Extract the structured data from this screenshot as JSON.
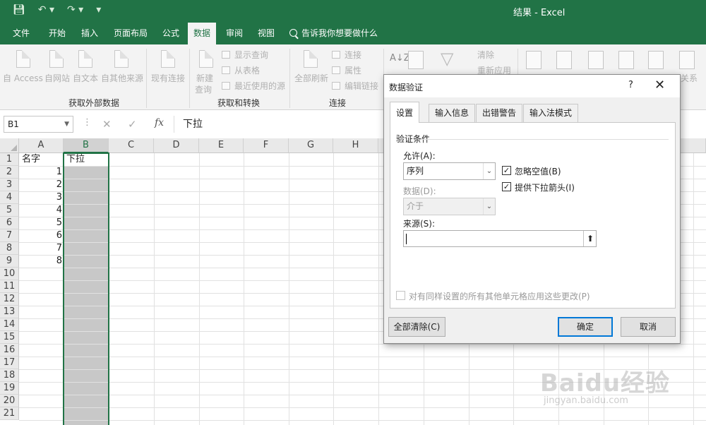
{
  "window": {
    "title": "结果  -  Excel"
  },
  "qat": {
    "save_icon": "save-icon",
    "undo_icon": "undo-icon",
    "redo_icon": "redo-icon"
  },
  "tabs": [
    {
      "label": "文件"
    },
    {
      "label": "开始"
    },
    {
      "label": "插入"
    },
    {
      "label": "页面布局"
    },
    {
      "label": "公式"
    },
    {
      "label": "数据",
      "active": true
    },
    {
      "label": "审阅"
    },
    {
      "label": "视图"
    }
  ],
  "tell_me": "告诉我你想要做什么",
  "ribbon": {
    "get_external": {
      "name": "获取外部数据",
      "access": "自 Access",
      "web": "自网站",
      "text": "自文本",
      "other": "自其他来源",
      "existing": "现有连接"
    },
    "get_transform": {
      "name": "获取和转换",
      "new_query": "新建",
      "new_query2": "查询",
      "show_query": "显示查询",
      "from_table": "从表格",
      "recent": "最近使用的源"
    },
    "connections": {
      "name": "连接",
      "refresh_all": "全部刷新",
      "connections": "连接",
      "properties": "属性",
      "edit_links": "编辑链接"
    },
    "sort_filter": {
      "clear": "清除",
      "reapply": "重新应用"
    },
    "relations": "关系"
  },
  "formula_bar": {
    "name_box": "B1",
    "value": "下拉"
  },
  "columns": [
    "A",
    "B",
    "C",
    "D",
    "E",
    "F",
    "G",
    "H"
  ],
  "rows": [
    "1",
    "2",
    "3",
    "4",
    "5",
    "6",
    "7",
    "8",
    "9",
    "10",
    "11",
    "12",
    "13",
    "14",
    "15",
    "16",
    "17",
    "18",
    "19",
    "20",
    "21"
  ],
  "cells": {
    "a1": "名字",
    "b1": "下拉",
    "a2": "1",
    "a3": "2",
    "a4": "3",
    "a5": "4",
    "a6": "5",
    "a7": "6",
    "a8": "7",
    "a9": "8"
  },
  "dialog": {
    "title": "数据验证",
    "help": "?",
    "close": "✕",
    "tabs": [
      "设置",
      "输入信息",
      "出错警告",
      "输入法模式"
    ],
    "group_label": "验证条件",
    "allow_label": "允许(A):",
    "allow_value": "序列",
    "data_label": "数据(D):",
    "data_value": "介于",
    "ignore_blank": "忽略空值(B)",
    "dropdown_arrow": "提供下拉箭头(I)",
    "source_label": "来源(S):",
    "source_value": "",
    "apply_all": "对有同样设置的所有其他单元格应用这些更改(P)",
    "clear_all": "全部清除(C)",
    "ok": "确定",
    "cancel": "取消"
  },
  "watermark": {
    "logo": "Baidu经验",
    "url": "jingyan.baidu.com"
  },
  "colors": {
    "accent": "#217346",
    "selected_column": "#c8c8c8",
    "primary_button": "#0078d7"
  }
}
